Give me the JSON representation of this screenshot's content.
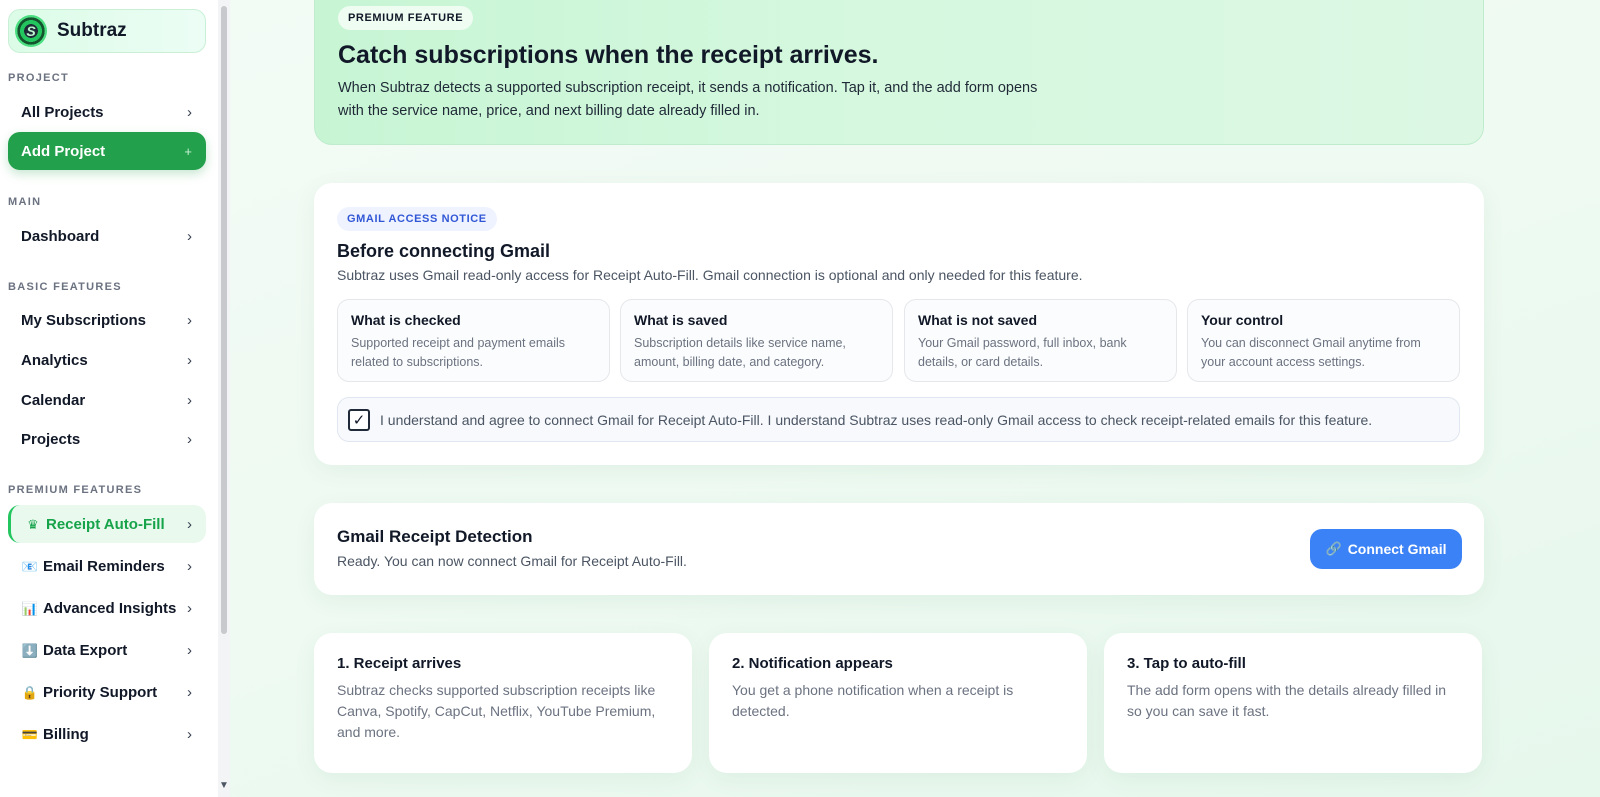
{
  "app": {
    "name": "Subtraz",
    "logo_letter": "S"
  },
  "sidebar": {
    "sections": {
      "project": "PROJECT",
      "main": "MAIN",
      "basic": "BASIC FEATURES",
      "premium": "PREMIUM FEATURES"
    },
    "items": {
      "all_projects": "All Projects",
      "add_project": "Add Project",
      "dashboard": "Dashboard",
      "my_subscriptions": "My Subscriptions",
      "analytics": "Analytics",
      "calendar": "Calendar",
      "projects": "Projects",
      "receipt_autofill": "Receipt Auto-Fill",
      "email_reminders": "Email Reminders",
      "advanced_insights": "Advanced Insights",
      "data_export": "Data Export",
      "priority_support": "Priority Support",
      "billing": "Billing"
    },
    "icons": {
      "receipt_autofill": "♛",
      "email_reminders": "📧",
      "advanced_insights": "📊",
      "data_export": "⬇️",
      "priority_support": "🔒",
      "billing": "💳"
    },
    "chevron": "›",
    "plus": "+"
  },
  "hero": {
    "badge": "PREMIUM FEATURE",
    "title": "Catch subscriptions when the receipt arrives.",
    "text": "When Subtraz detects a supported subscription receipt, it sends a notification. Tap it, and the add form opens with the service name, price, and next billing date already filled in."
  },
  "notice": {
    "badge": "GMAIL ACCESS NOTICE",
    "title": "Before connecting Gmail",
    "subtitle": "Subtraz uses Gmail read-only access for Receipt Auto-Fill. Gmail connection is optional and only needed for this feature.",
    "boxes": [
      {
        "title": "What is checked",
        "text": "Supported receipt and payment emails related to subscriptions."
      },
      {
        "title": "What is saved",
        "text": "Subscription details like service name, amount, billing date, and category."
      },
      {
        "title": "What is not saved",
        "text": "Your Gmail password, full inbox, bank details, or card details."
      },
      {
        "title": "Your control",
        "text": "You can disconnect Gmail anytime from your account access settings."
      }
    ],
    "agree_text": "I understand and agree to connect Gmail for Receipt Auto-Fill. I understand Subtraz uses read-only Gmail access to check receipt-related emails for this feature.",
    "agree_checked": true
  },
  "detection": {
    "title": "Gmail Receipt Detection",
    "status": "Ready. You can now connect Gmail for Receipt Auto-Fill.",
    "button_label": "Connect Gmail",
    "button_icon": "🔗"
  },
  "steps": [
    {
      "title": "1. Receipt arrives",
      "text": "Subtraz checks supported subscription receipts like Canva, Spotify, CapCut, Netflix, YouTube Premium, and more."
    },
    {
      "title": "2. Notification appears",
      "text": "You get a phone notification when a receipt is detected."
    },
    {
      "title": "3. Tap to auto-fill",
      "text": "The add form opens with the details already filled in so you can save it fast."
    }
  ],
  "colors": {
    "accent_green": "#22a04b",
    "button_blue": "#3b82f6",
    "notice_badge_blue": "#3157d6"
  }
}
